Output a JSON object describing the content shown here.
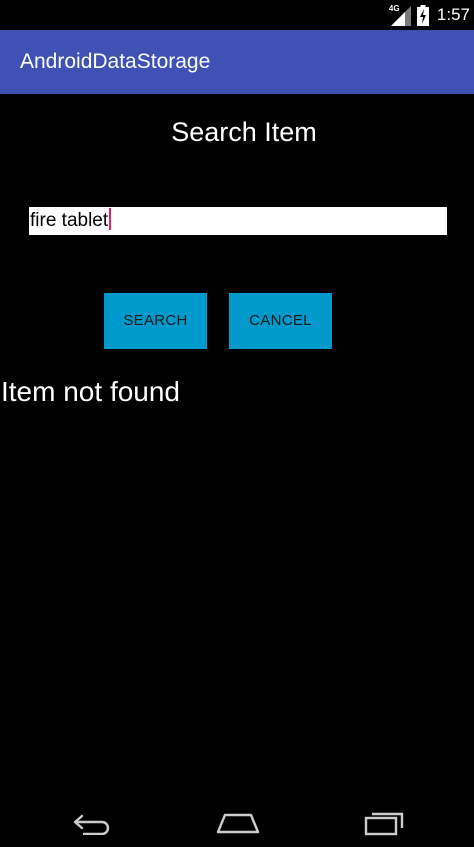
{
  "status_bar": {
    "network_type": "4G",
    "time": "1:57",
    "icons": [
      "signal-icon",
      "battery-charging-icon"
    ]
  },
  "app_bar": {
    "title": "AndroidDataStorage",
    "color": "#3f51b5"
  },
  "screen": {
    "title": "Search Item",
    "search_input": {
      "value": "fire tablet"
    },
    "buttons": {
      "search_label": "SEARCH",
      "cancel_label": "CANCEL",
      "color": "#0099cc"
    },
    "result_text": "Item not found"
  },
  "nav_bar": {
    "icons": [
      "back-icon",
      "home-icon",
      "recents-icon"
    ]
  }
}
